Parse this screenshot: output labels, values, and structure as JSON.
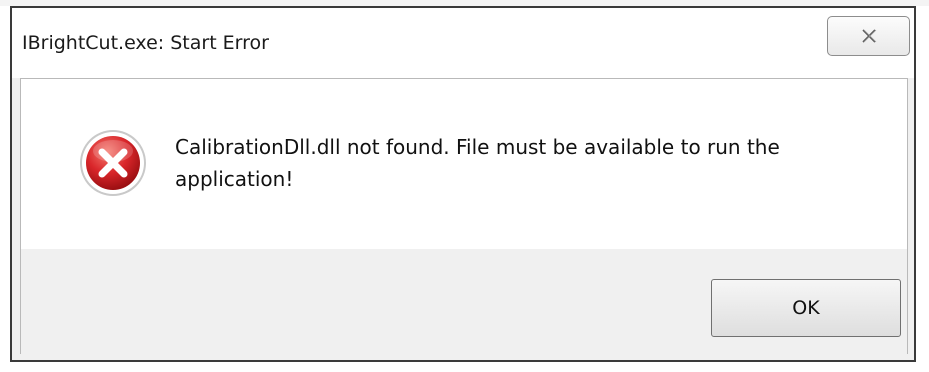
{
  "window": {
    "title": "IBrightCut.exe: Start Error",
    "close_icon": "close-x-icon"
  },
  "message": {
    "icon": "error-icon",
    "text": "CalibrationDll.dll not found. File must be available to run the application!"
  },
  "buttons": {
    "ok_label": "OK"
  },
  "colors": {
    "error_red": "#d9262a",
    "content_bg": "#ffffff",
    "footer_bg": "#f0f0f0",
    "window_border": "#3a3a3a"
  }
}
